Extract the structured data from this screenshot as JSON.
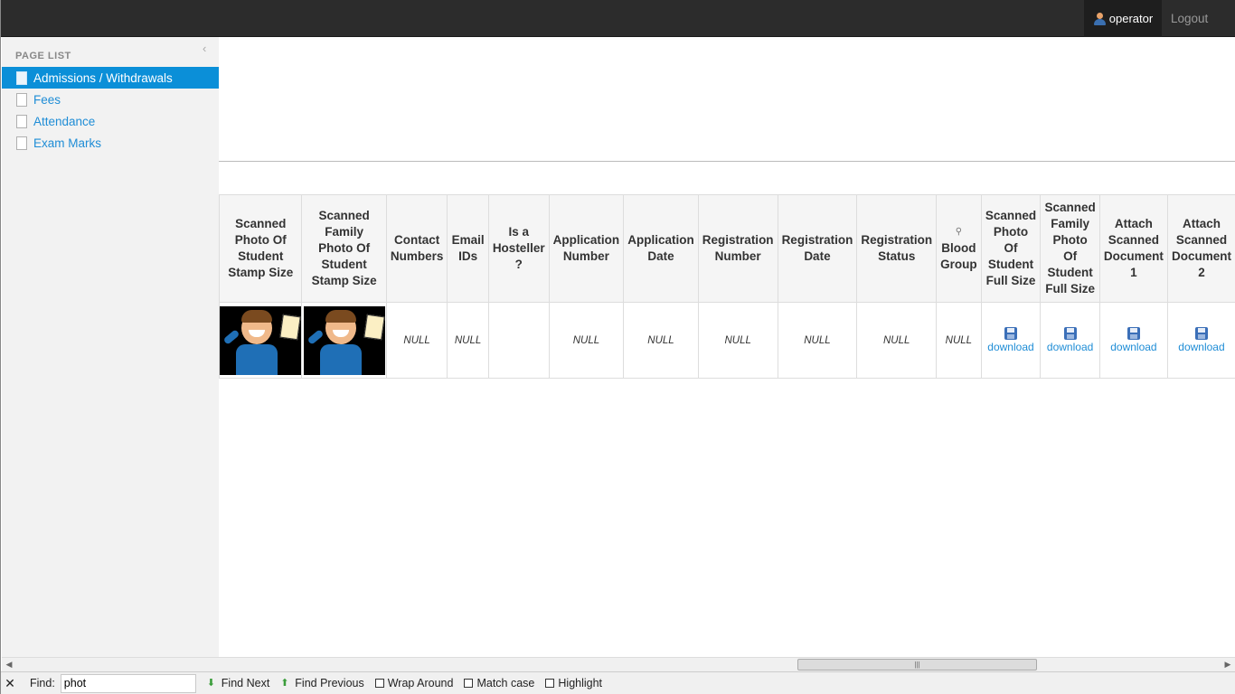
{
  "topbar": {
    "user": "operator",
    "logout": "Logout"
  },
  "sidebar": {
    "title": "PAGE LIST",
    "items": [
      {
        "label": "Admissions / Withdrawals",
        "active": true
      },
      {
        "label": "Fees"
      },
      {
        "label": "Attendance"
      },
      {
        "label": "Exam Marks"
      }
    ]
  },
  "table": {
    "headers": [
      "Scanned Photo Of Student Stamp Size",
      "Scanned Family Photo Of Student Stamp Size",
      "Contact Numbers",
      "Email IDs",
      "Is a Hosteller ?",
      "Application Number",
      "Application Date",
      "Registration Number",
      "Registration Date",
      "Registration Status",
      "Blood Group",
      "Scanned Photo Of Student Full Size",
      "Scanned Family Photo Of Student Full Size",
      "Attach Scanned Document 1",
      "Attach Scanned Document 2"
    ],
    "row": {
      "contact": "NULL",
      "email": "NULL",
      "hosteller": "",
      "app_number": "NULL",
      "app_date": "NULL",
      "reg_number": "NULL",
      "reg_date": "NULL",
      "reg_status": "NULL",
      "blood_group": "NULL",
      "download": "download"
    }
  },
  "findbar": {
    "label": "Find:",
    "value": "phot",
    "find_next": "Find Next",
    "find_previous": "Find Previous",
    "wrap_around": "Wrap Around",
    "match_case": "Match case",
    "highlight": "Highlight"
  },
  "colors": {
    "accent": "#0b8fd8",
    "link": "#1f8dd6",
    "topbar": "#2c2c2c"
  }
}
